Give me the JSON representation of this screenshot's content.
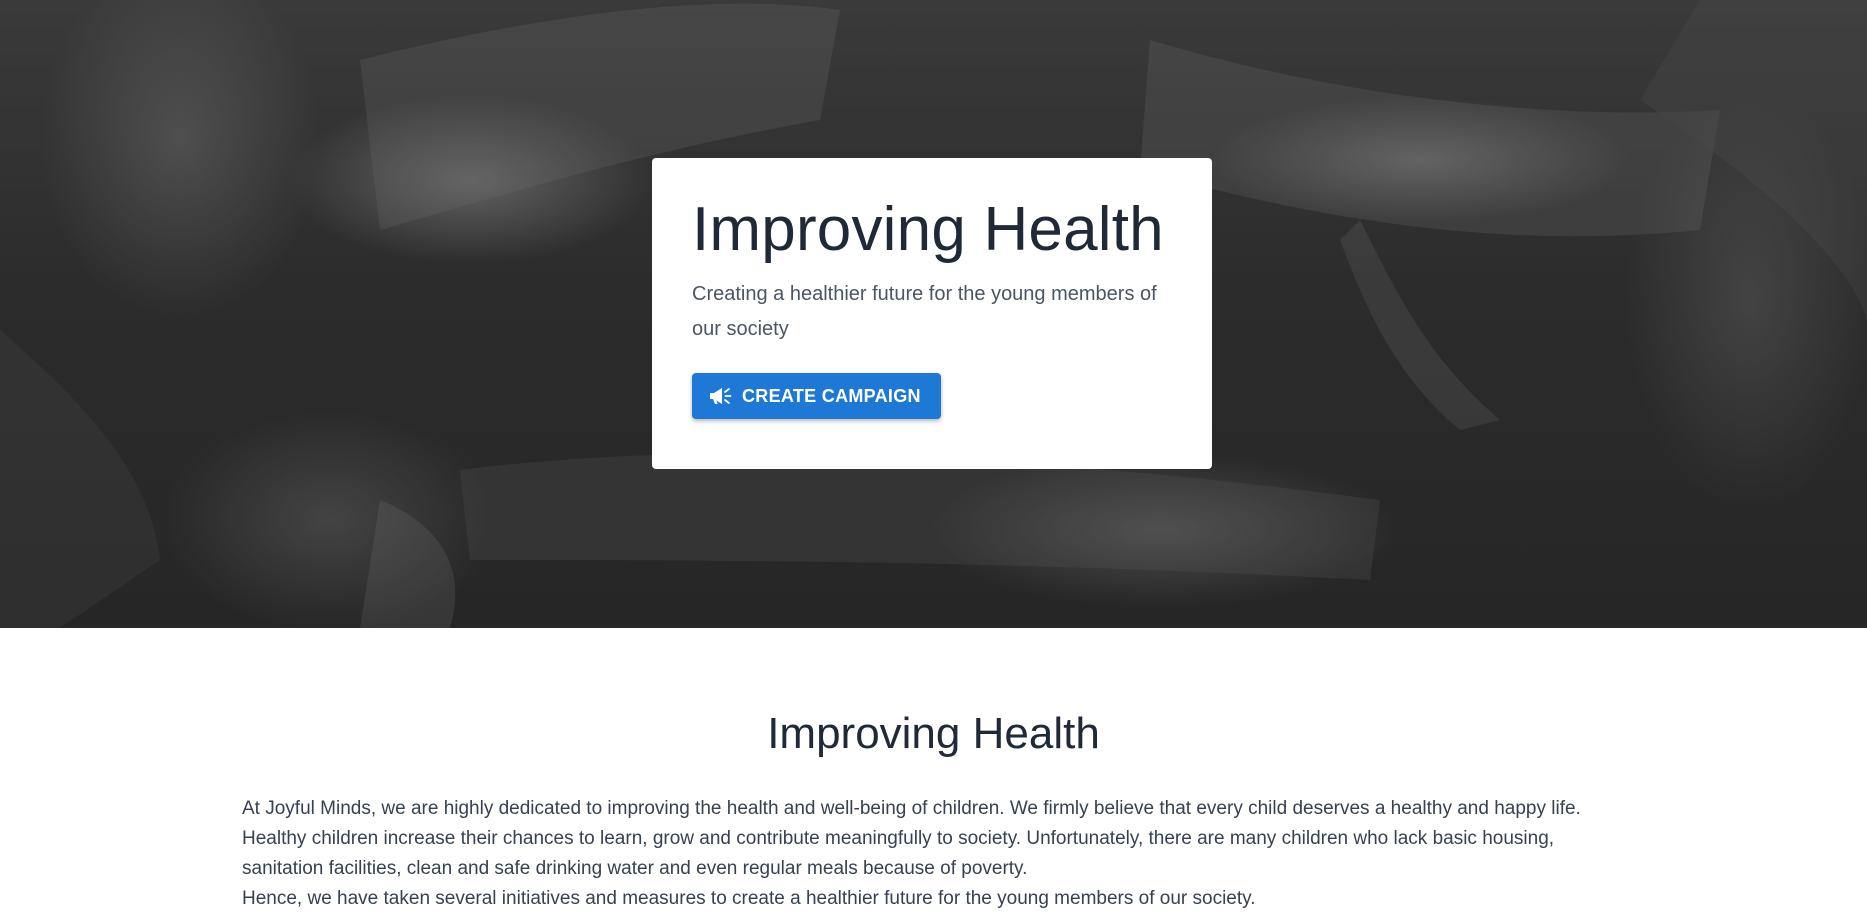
{
  "hero": {
    "title": "Improving Health",
    "subtitle": "Creating a healthier future for the young members of our society",
    "cta": {
      "label": "CREATE CAMPAIGN",
      "icon": "megaphone-icon",
      "color": "#1e78d6"
    }
  },
  "section": {
    "title": "Improving Health",
    "paragraph_1": "At Joyful Minds, we are highly dedicated to improving the health and well-being of children. We firmly believe that every child deserves a healthy and happy life. Healthy children increase their chances to learn, grow and contribute meaningfully to society. Unfortunately, there are many children who lack basic housing, sanitation facilities, clean and safe drinking water and even regular meals because of poverty.",
    "paragraph_2": "Hence, we have taken several initiatives and measures to create a healthier future for the young members of our society."
  }
}
